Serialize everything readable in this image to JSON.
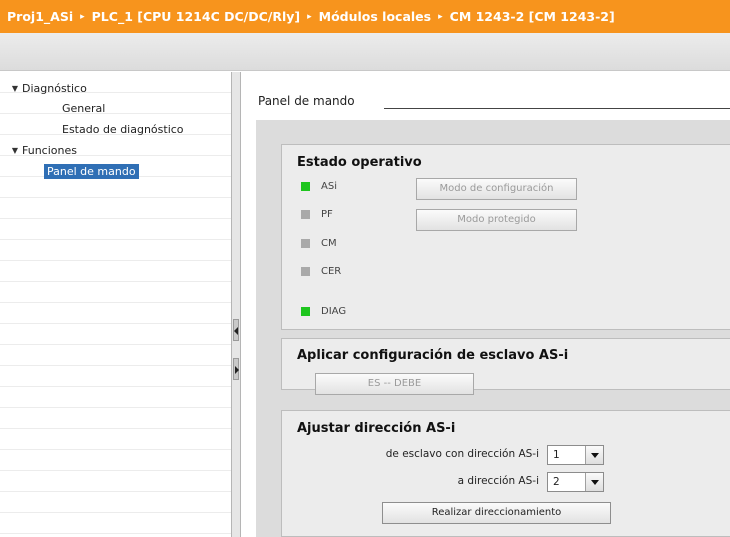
{
  "breadcrumb": {
    "items": [
      "Proj1_ASi",
      "PLC_1 [CPU 1214C DC/DC/Rly]",
      "Módulos locales",
      "CM 1243-2 [CM 1243-2]"
    ],
    "separator": "▸"
  },
  "tree": {
    "items": [
      {
        "label": "Diagnóstico",
        "level": 0,
        "expanded": true
      },
      {
        "label": "General",
        "level": 1
      },
      {
        "label": "Estado de diagnóstico",
        "level": 1
      },
      {
        "label": "Funciones",
        "level": 0,
        "expanded": true
      },
      {
        "label": "Panel de mando",
        "level": 1,
        "selected": true
      }
    ]
  },
  "main": {
    "section_title": "Panel de mando",
    "operating_state": {
      "title": "Estado operativo",
      "leds": [
        {
          "label": "ASi",
          "state": "on"
        },
        {
          "label": "PF",
          "state": "off"
        },
        {
          "label": "CM",
          "state": "off"
        },
        {
          "label": "CER",
          "state": "off"
        },
        {
          "label": "DIAG",
          "state": "on"
        }
      ],
      "config_mode_button": "Modo de configuración",
      "protected_mode_button": "Modo protegido"
    },
    "apply_config": {
      "title": "Aplicar configuración de esclavo AS-i",
      "button": "ES -- DEBE"
    },
    "set_address": {
      "title": "Ajustar dirección AS-i",
      "from_label": "de esclavo con dirección AS-i",
      "from_value": "1",
      "to_label": "a dirección AS-i",
      "to_value": "2",
      "button": "Realizar direccionamiento"
    }
  },
  "colors": {
    "titlebar": "#f7941d",
    "led_on": "#1ec51e",
    "led_off": "#a9a9a9",
    "selection": "#2f6fb5"
  }
}
